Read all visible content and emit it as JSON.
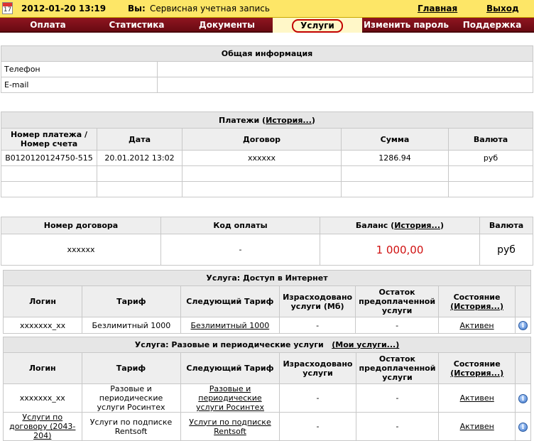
{
  "topbar": {
    "date": "2012-01-20 13:19",
    "you_label": "Вы:",
    "account": "Сервисная учетная запись",
    "home_link": "Главная",
    "exit_link": "Выход",
    "calendar_num": "17"
  },
  "nav": [
    "Оплата",
    "Статистика",
    "Документы",
    "Услуги",
    "Изменить пароль",
    "Поддержка"
  ],
  "general": {
    "title": "Общая информация",
    "phone_label": "Телефон",
    "email_label": "E-mail"
  },
  "payments": {
    "title": "Платежи (",
    "history": "История...",
    "close": ")",
    "headers": [
      "Номер платежа / Номер счета",
      "Дата",
      "Договор",
      "Сумма",
      "Валюта"
    ],
    "rows": [
      [
        "B0120120124750-515",
        "20.01.2012 13:02",
        "xxxxxx",
        "1286.94",
        "руб"
      ]
    ]
  },
  "contract": {
    "headers": [
      "Номер договора",
      "Код оплаты",
      "Баланс (",
      "Валюта"
    ],
    "balance_history": "История...",
    "balance_close": ")",
    "number": "xxxxxx",
    "pay_code": "-",
    "balance": "1 000,00",
    "currency": "руб"
  },
  "internet": {
    "title": "Услуга: Доступ в Интернет",
    "headers": [
      "Логин",
      "Тариф",
      "Следующий Тариф",
      "Израсходовано услуги (Мб)",
      "Остаток предоплаченной услуги",
      "Состояние"
    ],
    "status_history": "(История...)",
    "row": {
      "login": "xxxxxxx_xx",
      "tariff": "Безлимитный 1000",
      "next_tariff": "Безлимитный 1000",
      "used": "-",
      "rest": "-",
      "state": "Активен"
    }
  },
  "periodic": {
    "title": "Услуга: Разовые и периодические услуги",
    "my_services": "(Мои услуги...)",
    "headers": [
      "Логин",
      "Тариф",
      "Следующий Тариф",
      "Израсходовано услуги",
      "Остаток предоплаченной услуги",
      "Состояние"
    ],
    "status_history": "(История...)",
    "rows": [
      {
        "login": "xxxxxxx_xx",
        "tariff": "Разовые и периодические услуги Росинтех",
        "next_tariff": "Разовые и периодические услуги Росинтех",
        "used": "-",
        "rest": "-",
        "state": "Активен"
      },
      {
        "login": "Услуги по договору (2043-204)",
        "tariff": "Услуги по подписке Rentsoft",
        "next_tariff": "Услуги по подписке Rentsoft",
        "used": "-",
        "rest": "-",
        "state": "Активен"
      }
    ]
  },
  "icons": {
    "info": "info-icon",
    "calendar": "calendar-icon"
  },
  "colors": {
    "topbar": "#fde667",
    "navbar": "#7d1019",
    "balance": "#d01010"
  }
}
